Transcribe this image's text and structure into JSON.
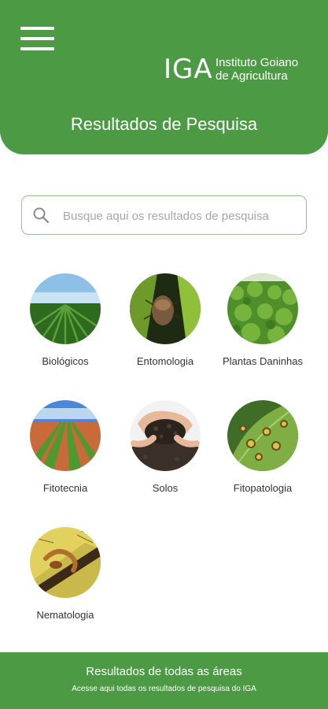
{
  "header": {
    "menu_icon": "hamburger-menu-icon",
    "logo": {
      "mark": "IGA",
      "line1": "Instituto Goiano",
      "line2": "de Agricultura"
    },
    "title": "Resultados de Pesquisa"
  },
  "search": {
    "icon": "search-icon",
    "placeholder": "Busque aqui os resultados de pesquisa",
    "value": ""
  },
  "categories": [
    {
      "label": "Biológicos",
      "icon": "crop-field-icon"
    },
    {
      "label": "Entomologia",
      "icon": "insect-icon"
    },
    {
      "label": "Plantas Daninhas",
      "icon": "weeds-icon"
    },
    {
      "label": "Fitotecnia",
      "icon": "crop-rows-icon"
    },
    {
      "label": "Solos",
      "icon": "soil-icon"
    },
    {
      "label": "Fitopatologia",
      "icon": "diseased-leaf-icon"
    },
    {
      "label": "Nematologia",
      "icon": "nematode-icon"
    }
  ],
  "footer": {
    "title": "Resultados de todas as áreas",
    "subtitle": "Acesse aqui todas os resultados de pesquisa do IGA"
  },
  "colors": {
    "brand_green": "#4c9a43",
    "search_border": "#8fc487",
    "text": "#333333"
  }
}
